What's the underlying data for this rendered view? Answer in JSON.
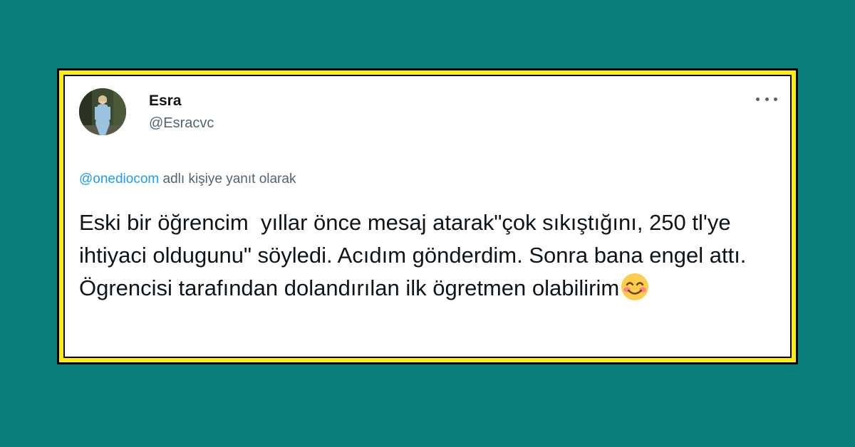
{
  "tweet": {
    "author_name": "Esra",
    "author_handle": "@Esracvc",
    "reply_prefix": "@onediocom",
    "reply_suffix": " adlı kişiye yanıt olarak",
    "text": "Eski bir öğrencim  yıllar önce mesaj atarak\"çok sıkıştığını, 250 tl'ye ihtiyaci oldugunu\" söyledi. Acıdım gönderdim. Sonra bana engel attı. Ögrencisi tarafından dolandırılan ilk ögretmen olabilirim",
    "emoji_icon": "smiling-face-with-smiling-eyes-icon",
    "more_icon": "more-options-icon"
  },
  "colors": {
    "background": "#0b7d7a",
    "frame_yellow": "#ffee00",
    "frame_black": "#000000",
    "card": "#ffffff",
    "text_primary": "#0f1419",
    "text_secondary": "#536471",
    "mention_blue": "#1d9bf0"
  }
}
